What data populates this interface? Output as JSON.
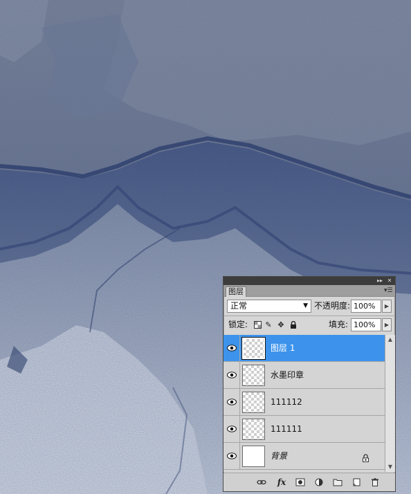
{
  "panel": {
    "title": "图层",
    "collapse_icon": "double-chevron-right-icon",
    "close_icon": "close-icon",
    "menu_icon": "panel-menu-icon"
  },
  "blend": {
    "mode": "正常",
    "opacity_label": "不透明度:",
    "opacity_value": "100%"
  },
  "lock": {
    "label": "锁定:",
    "fill_label": "填充:",
    "fill_value": "100%",
    "icons": [
      "lock-transparent-icon",
      "lock-brush-icon",
      "lock-move-icon",
      "lock-all-icon"
    ]
  },
  "layers": [
    {
      "name": "图层 1",
      "selected": true,
      "visible": true,
      "thumb": "transparent"
    },
    {
      "name": "水墨印章",
      "selected": false,
      "visible": true,
      "thumb": "transparent"
    },
    {
      "name": "111112",
      "selected": false,
      "visible": true,
      "thumb": "transparent"
    },
    {
      "name": "111111",
      "selected": false,
      "visible": true,
      "thumb": "transparent"
    },
    {
      "name": "背景",
      "selected": false,
      "visible": true,
      "thumb": "white",
      "locked": true
    }
  ],
  "bottom_icons": [
    "link-layers-icon",
    "fx-icon",
    "add-mask-icon",
    "adjustment-layer-icon",
    "new-group-icon",
    "new-layer-icon",
    "trash-icon"
  ],
  "fx_label": "fx",
  "colors": {
    "selected": "#3d93ec",
    "panel_bg": "#d6d6d6",
    "ink_dark": "#1d2f5c",
    "ink_mid": "#5d6b86",
    "paper": "#dfe3ea"
  }
}
